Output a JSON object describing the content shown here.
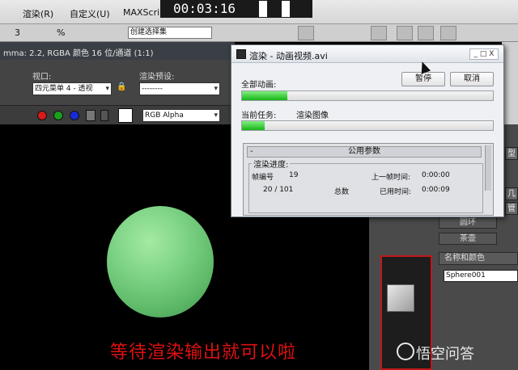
{
  "menubar": {
    "items": [
      "渲染(R)",
      "自定义(U)",
      "MAXScript(X)"
    ],
    "timer": "00:03:16"
  },
  "toolbar": {
    "selection_set": "创建选择集"
  },
  "render_frame": {
    "status": "mma: 2.2, RGBA 颜色 16 位/通道 (1:1)",
    "viewport_label": "视口:",
    "viewport_value": "四元菜单 4 - 透视",
    "preset_label": "渲染预设:",
    "preset_value": "--------",
    "channel_value": "RGB Alpha",
    "colors": {
      "red": "#d81a1a",
      "green": "#1aa01a",
      "blue": "#1a2ad8"
    }
  },
  "dialog": {
    "title": "渲染 - 动画视频.avi",
    "close_label": "_ □ X",
    "total_label": "全部动画:",
    "pause_label": "暂停",
    "cancel_label": "取消",
    "current_label": "当前任务:",
    "current_value": "渲染图像",
    "total_progress": 0.18,
    "current_progress": 0.09,
    "params_title": "公用参数",
    "params_minus": "-",
    "group_title": "渲染进度:",
    "frame_label": "帧编号",
    "frame_value": "19",
    "last_frame_label": "上一帧时间:",
    "last_frame_value": "0:00:00",
    "count_value": "20  /  101",
    "total_count_label": "总数",
    "elapsed_label": "已用时间:",
    "elapsed_value": "0:00:09"
  },
  "command_panel": {
    "torus_label": "圆环",
    "teapot_label": "茶壶",
    "name_color_label": "名称和颜色",
    "object_name": "Sphere001",
    "side_labels": [
      "型",
      "几",
      "管"
    ]
  },
  "subtitle": "等待渲染输出就可以啦",
  "watermark": "悟空问答"
}
